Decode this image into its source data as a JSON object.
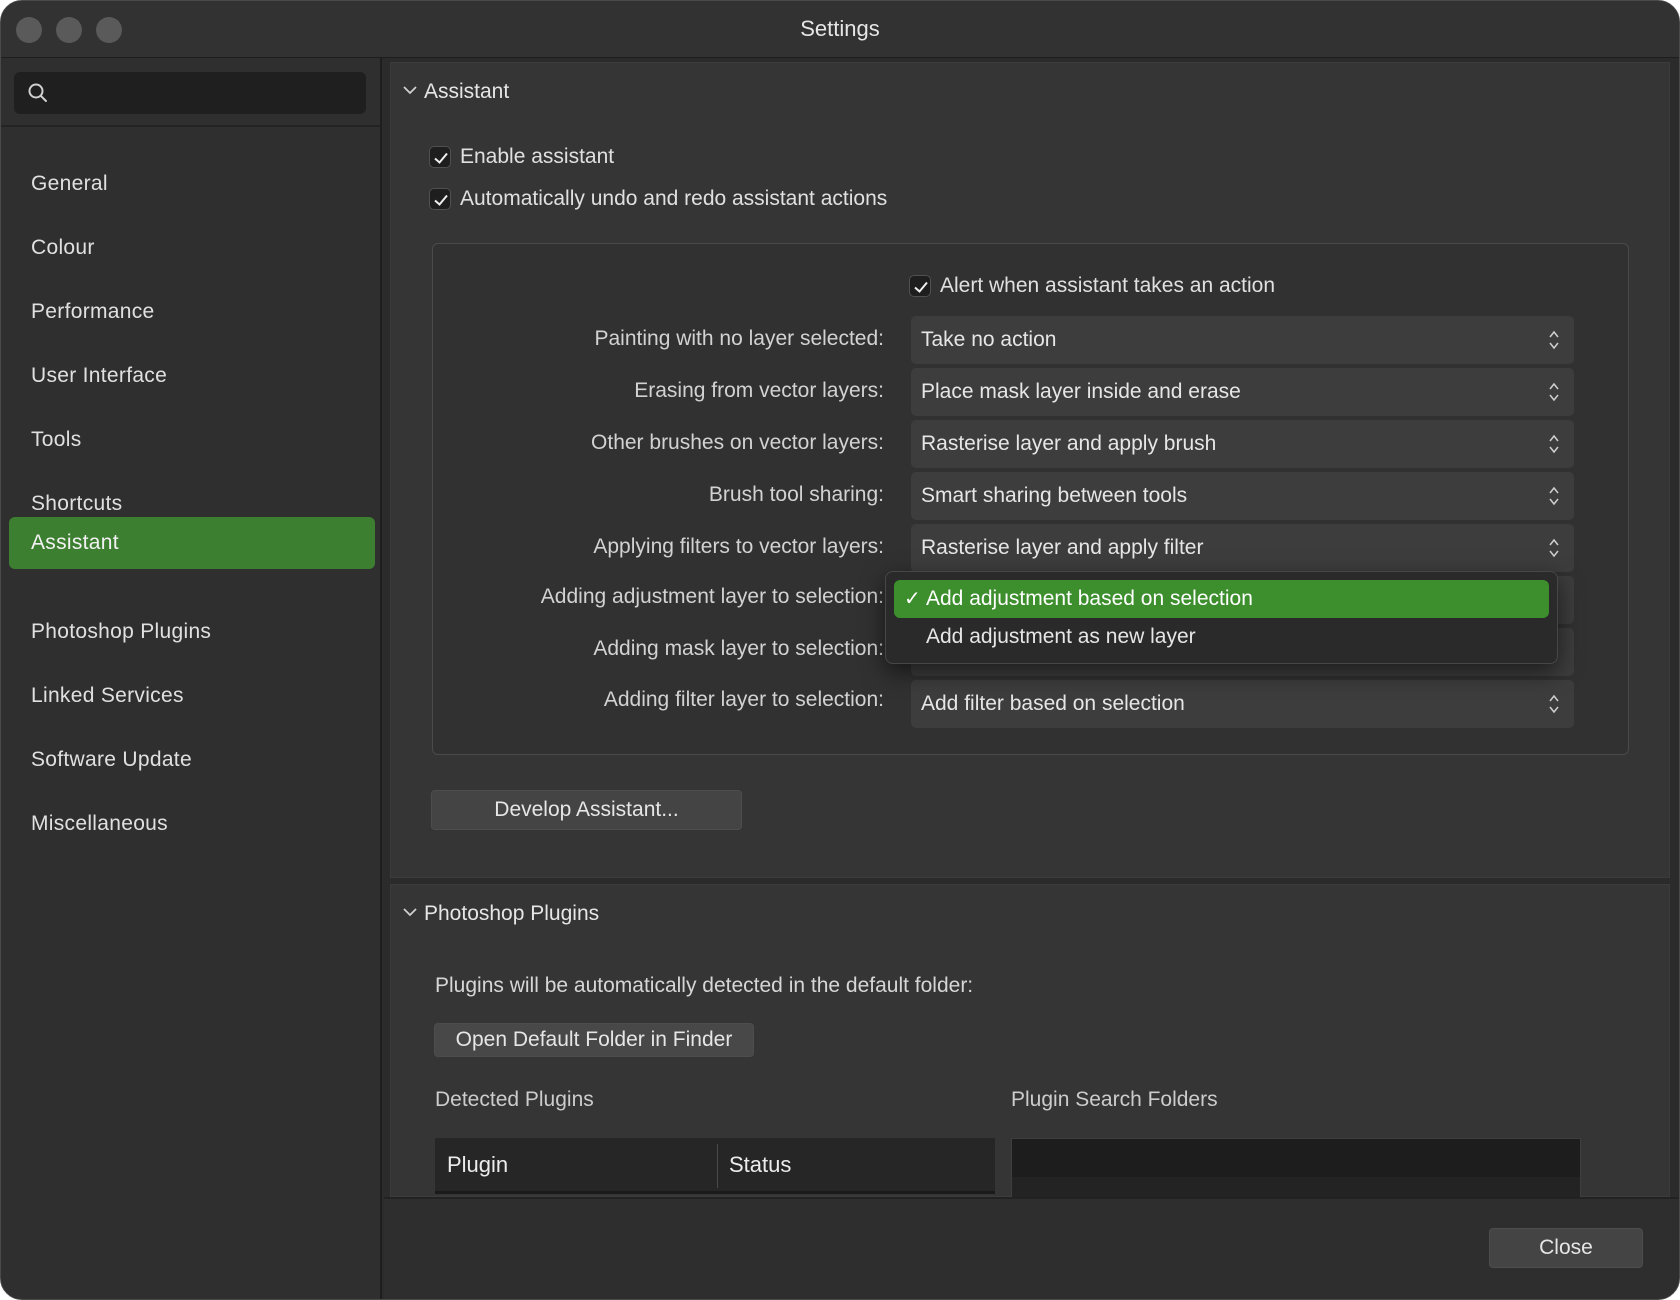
{
  "window": {
    "title": "Settings"
  },
  "search": {
    "placeholder": ""
  },
  "sidebar": {
    "items": [
      {
        "label": "General"
      },
      {
        "label": "Colour"
      },
      {
        "label": "Performance"
      },
      {
        "label": "User Interface"
      },
      {
        "label": "Tools"
      },
      {
        "label": "Shortcuts"
      },
      {
        "label": "Assistant",
        "active": true
      },
      {
        "label": "Photoshop Plugins"
      },
      {
        "label": "Linked Services"
      },
      {
        "label": "Software Update"
      },
      {
        "label": "Miscellaneous"
      }
    ]
  },
  "assistant": {
    "title": "Assistant",
    "enable_label": "Enable assistant",
    "enable_checked": true,
    "auto_undo_label": "Automatically undo and redo assistant actions",
    "auto_undo_checked": true,
    "alert_label": "Alert when assistant takes an action",
    "alert_checked": true,
    "rows": [
      {
        "label": "Painting with no layer selected:",
        "value": "Take no action"
      },
      {
        "label": "Erasing from vector layers:",
        "value": "Place mask layer inside and erase"
      },
      {
        "label": "Other brushes on vector layers:",
        "value": "Rasterise layer and apply brush"
      },
      {
        "label": "Brush tool sharing:",
        "value": "Smart sharing between tools"
      },
      {
        "label": "Applying filters to vector layers:",
        "value": "Rasterise layer and apply filter"
      },
      {
        "label": "Adding adjustment layer to selection:",
        "value": ""
      },
      {
        "label": "Adding mask layer to selection:",
        "value": ""
      },
      {
        "label": "Adding filter layer to selection:",
        "value": "Add filter based on selection"
      }
    ],
    "develop_button": "Develop Assistant..."
  },
  "dropdown_menu": {
    "check_glyph": "✓",
    "options": [
      {
        "label": "Add adjustment based on selection",
        "selected": true
      },
      {
        "label": "Add adjustment as new layer",
        "selected": false
      }
    ]
  },
  "plugins": {
    "title": "Photoshop Plugins",
    "description": "Plugins will be automatically detected in the default folder:",
    "open_folder_button": "Open Default Folder in Finder",
    "detected_label": "Detected Plugins",
    "search_folders_label": "Plugin Search Folders",
    "columns": [
      "Plugin",
      "Status"
    ]
  },
  "footer": {
    "close_button": "Close"
  },
  "colors": {
    "accent_green": "#3d7f31",
    "menu_highlight": "#3c8f2c",
    "background": "#2b2b2b"
  }
}
